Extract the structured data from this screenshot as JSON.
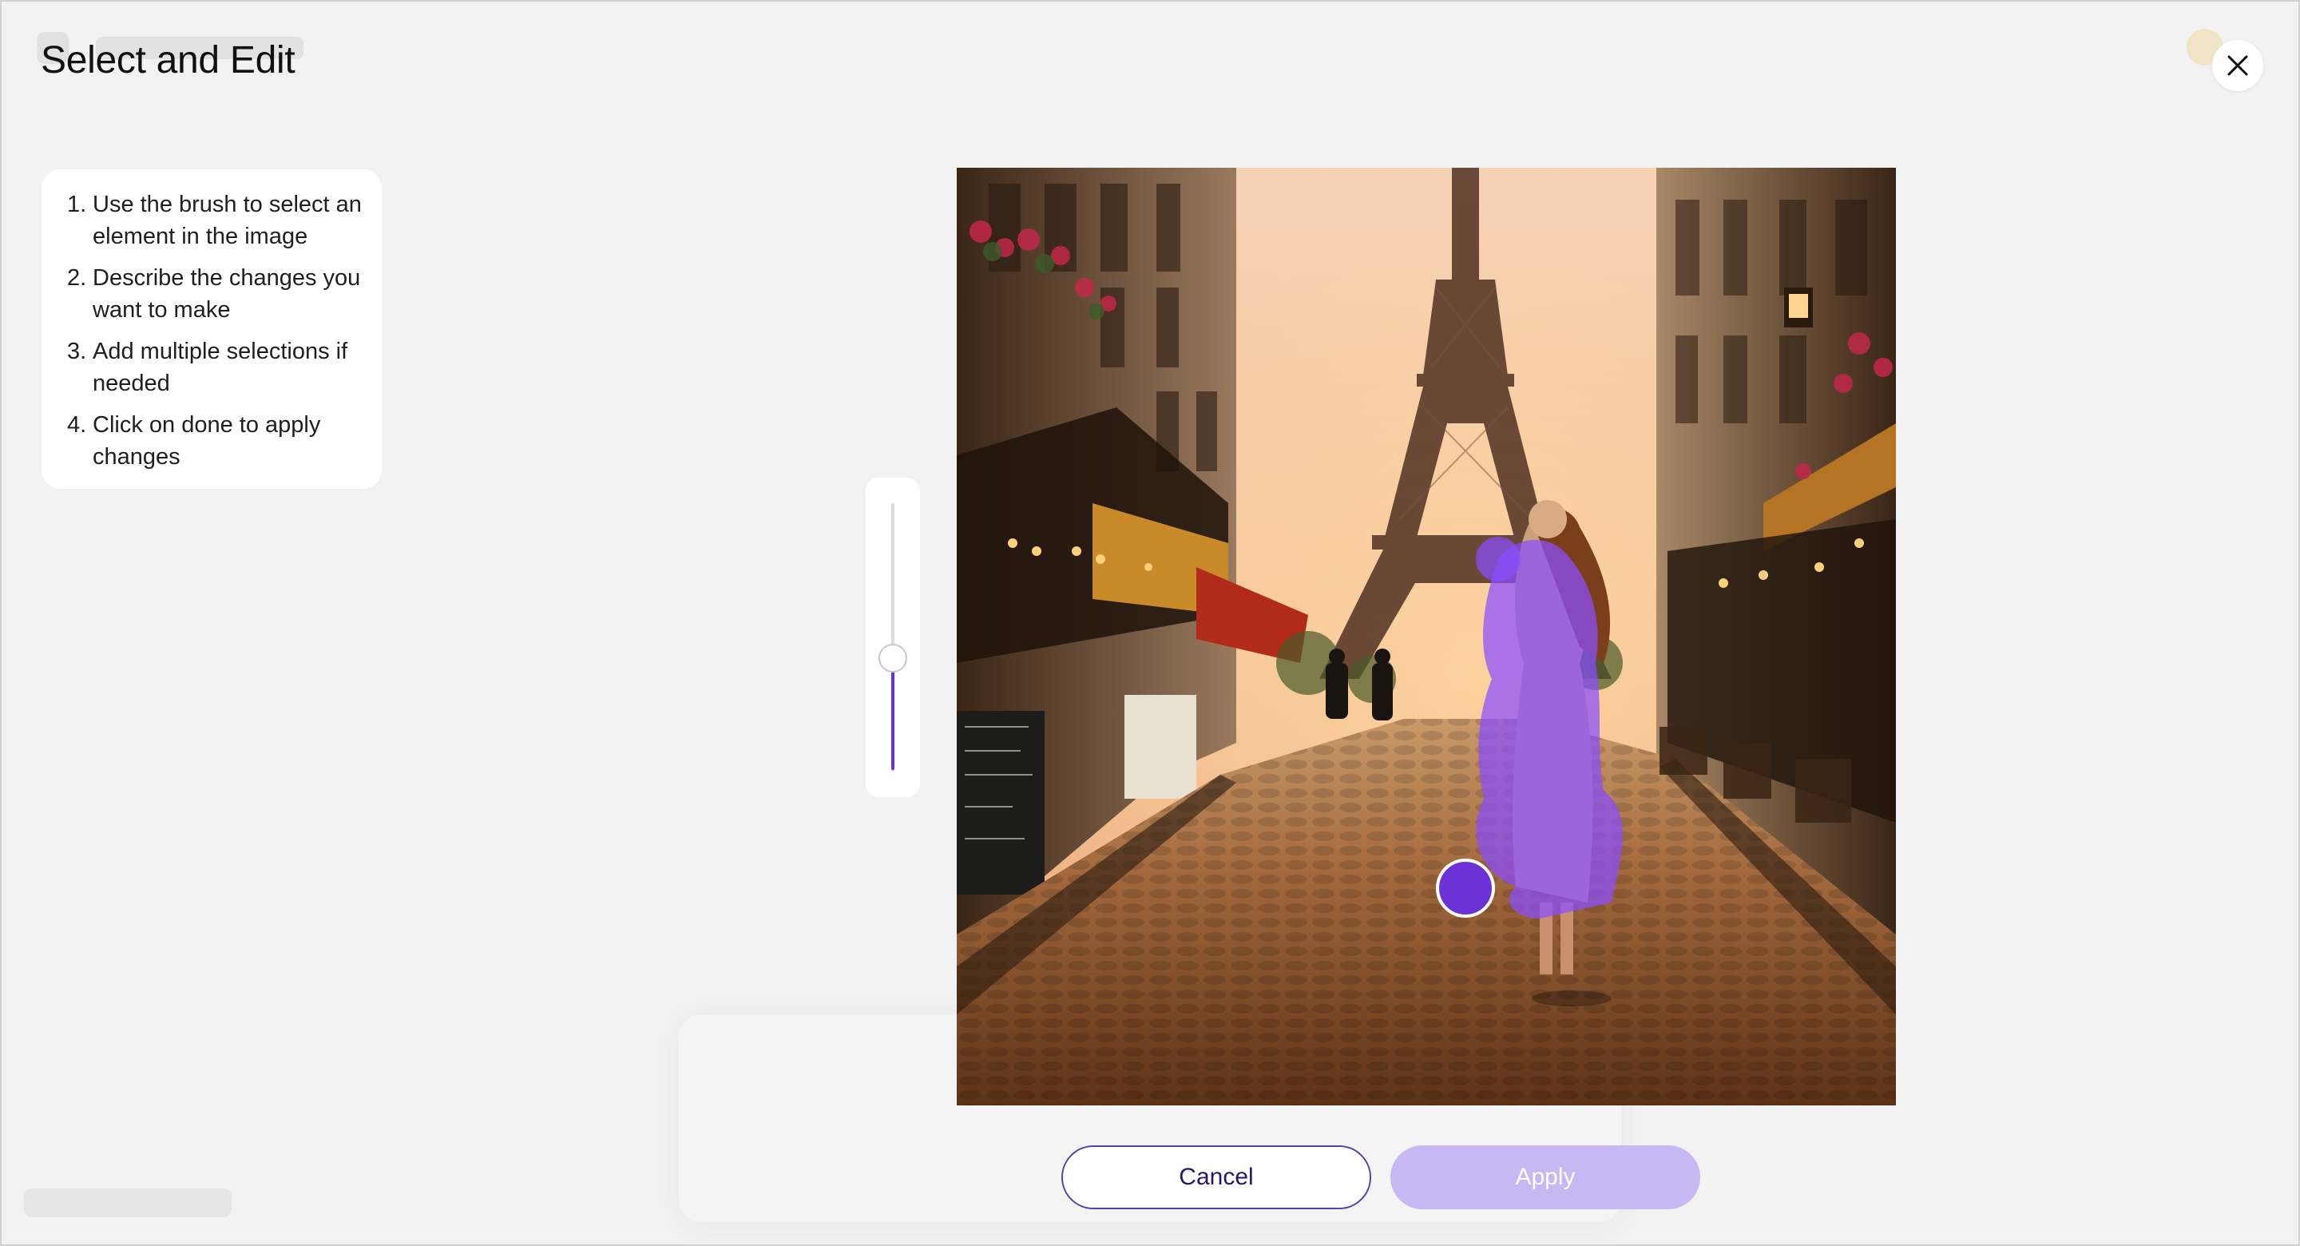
{
  "modal": {
    "title": "Select and Edit",
    "close_icon": "close-icon"
  },
  "instructions": [
    {
      "num": "1.",
      "text": "Use the brush to select an element in the image"
    },
    {
      "num": "2.",
      "text": "Describe the changes you want to make"
    },
    {
      "num": "3.",
      "text": "Add multiple selections if needed"
    },
    {
      "num": "4.",
      "text": "Click on done to apply changes"
    }
  ],
  "brush_size": {
    "level": 0.42
  },
  "image": {
    "description_icon": "photo-woman-eiffel-tower",
    "selection_color": "#8a4dff"
  },
  "actions": {
    "cancel_label": "Cancel",
    "apply_label": "Apply"
  },
  "colors": {
    "accent": "#6b33d6",
    "apply_disabled": "#c7b8f4"
  }
}
